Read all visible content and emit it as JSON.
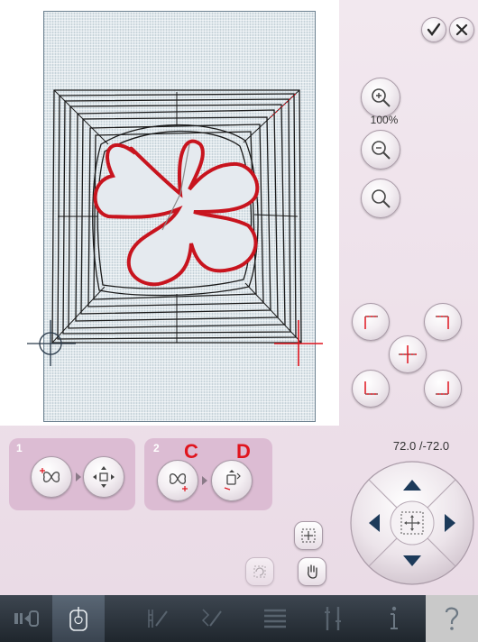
{
  "window": {
    "zoom_label": "100%",
    "position_readout": "72.0 /-72.0"
  },
  "top_actions": [
    {
      "icon": "checkmark-icon"
    },
    {
      "icon": "close-icon"
    }
  ],
  "zoom": [
    {
      "icon": "zoom-in-icon"
    },
    {
      "icon": "zoom-out-icon"
    },
    {
      "icon": "zoom-to-fit-icon"
    }
  ],
  "corner_positions": [
    "top-left-corner",
    "top-right-corner",
    "center",
    "bottom-left-corner",
    "bottom-right-corner"
  ],
  "panels": [
    {
      "number": "1",
      "buttons": [
        "design-position-icon",
        "move-icon"
      ]
    },
    {
      "number": "2",
      "buttons": [
        "design-point-icon",
        "rotate-move-icon"
      ],
      "annotations": [
        "C",
        "D"
      ]
    }
  ],
  "dpad": {
    "directions": [
      "up",
      "down",
      "left",
      "right"
    ],
    "center_icon": "center-move-icon"
  },
  "tool_buttons": [
    {
      "icon": "move-to-center-icon",
      "enabled": true
    },
    {
      "icon": "rotate-icon",
      "enabled": false
    },
    {
      "icon": "pan-hand-icon",
      "enabled": true
    }
  ],
  "taskbar": [
    {
      "icon": "sew-mode-icon"
    },
    {
      "icon": "embroidery-icon",
      "active": true
    },
    {
      "icon": "stitch-edit-icon"
    },
    {
      "icon": "stitch-program-icon"
    },
    {
      "icon": "sequence-icon"
    },
    {
      "icon": "settings-icon"
    },
    {
      "icon": "info-icon"
    },
    {
      "icon": "help-icon"
    }
  ],
  "colors": {
    "accent_red": "#e0141e",
    "panel": "#dcbcd3",
    "taskbar": "#1f262d"
  }
}
